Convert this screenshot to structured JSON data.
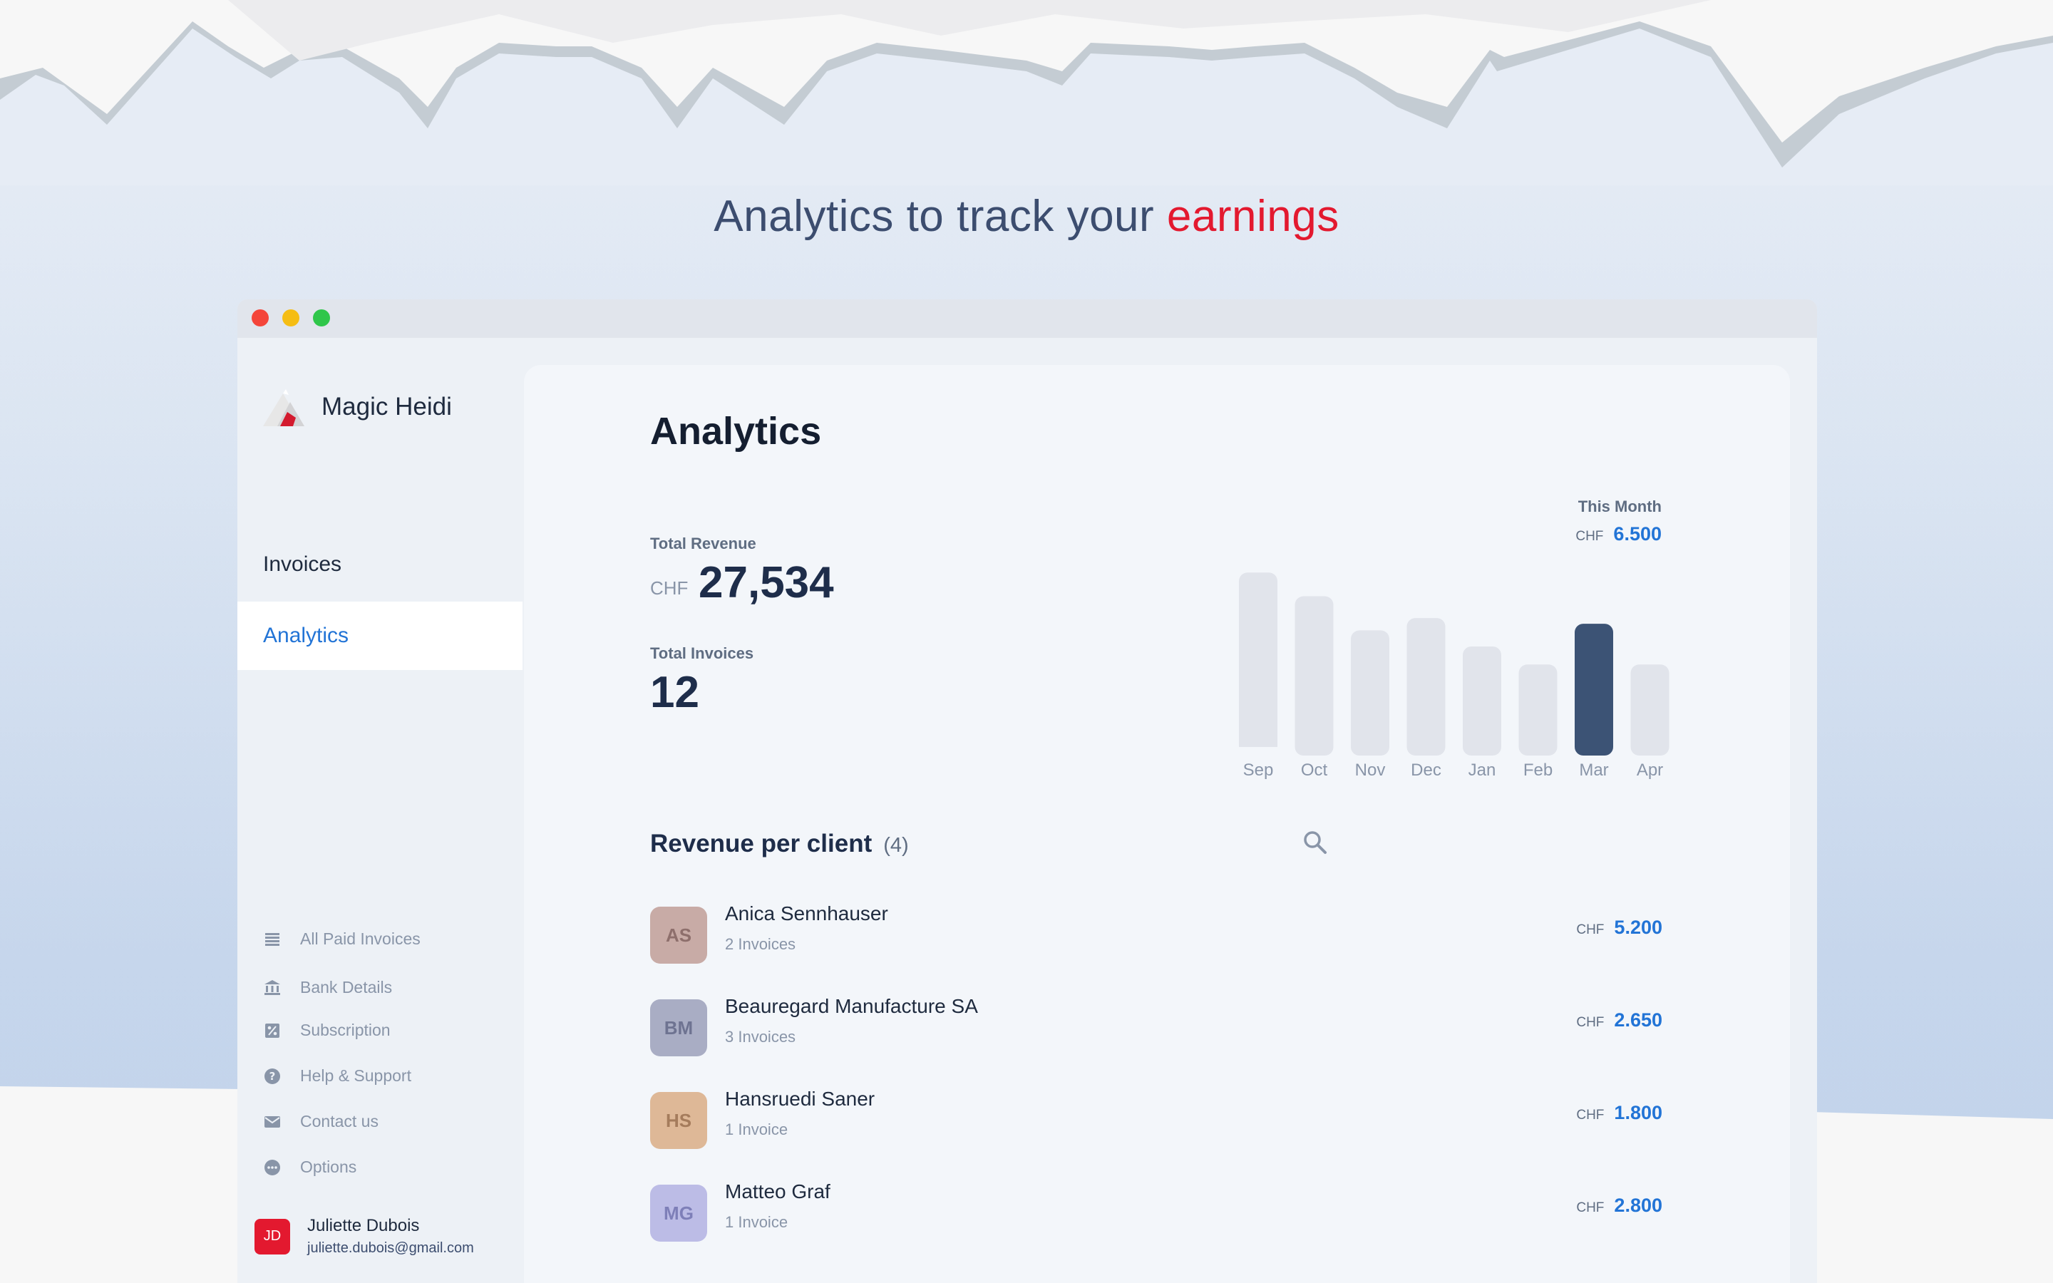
{
  "headline": {
    "prefix": "Analytics to track your",
    "accent": "earnings"
  },
  "app": {
    "name": "Magic Heidi"
  },
  "sidebar": {
    "nav": [
      {
        "label": "Invoices",
        "active": false
      },
      {
        "label": "Analytics",
        "active": true
      }
    ],
    "settings": [
      {
        "label": "All Paid Invoices",
        "icon": "list-icon"
      },
      {
        "label": "Bank Details",
        "icon": "bank-icon"
      },
      {
        "label": "Subscription",
        "icon": "percent-icon"
      },
      {
        "label": "Help & Support",
        "icon": "help-icon"
      },
      {
        "label": "Contact us",
        "icon": "mail-icon"
      },
      {
        "label": "Options",
        "icon": "options-icon"
      }
    ],
    "user": {
      "initials": "JD",
      "name": "Juliette Dubois",
      "email": "juliette.dubois@gmail.com"
    }
  },
  "main": {
    "title": "Analytics",
    "total_revenue": {
      "label": "Total Revenue",
      "currency": "CHF",
      "value": "27,534"
    },
    "total_invoices": {
      "label": "Total Invoices",
      "value": "12"
    },
    "this_month": {
      "label": "This Month",
      "currency": "CHF",
      "value": "6.500"
    },
    "revenue_section": {
      "title": "Revenue per client",
      "count": "(4)"
    },
    "clients": [
      {
        "initials": "AS",
        "name": "Anica Sennhauser",
        "invoices": "2 Invoices",
        "currency": "CHF",
        "amount": "5.200",
        "bg": "#c8aba6",
        "fg": "#8e6f6c"
      },
      {
        "initials": "BM",
        "name": "Beauregard Manufacture SA",
        "invoices": "3 Invoices",
        "currency": "CHF",
        "amount": "2.650",
        "bg": "#a9adc4",
        "fg": "#6e7391"
      },
      {
        "initials": "HS",
        "name": "Hansruedi Saner",
        "invoices": "1 Invoice",
        "currency": "CHF",
        "amount": "1.800",
        "bg": "#deb897",
        "fg": "#a57c5c"
      },
      {
        "initials": "MG",
        "name": "Matteo Graf",
        "invoices": "1 Invoice",
        "currency": "CHF",
        "amount": "2.800",
        "bg": "#bcbce6",
        "fg": "#7e7fb8"
      }
    ]
  },
  "colors": {
    "accent_red": "#e3192f",
    "accent_blue": "#2274d6",
    "bar_default": "#e1e4eb",
    "bar_active": "#3c5375"
  },
  "chart_data": {
    "type": "bar",
    "categories": [
      "Sep",
      "Oct",
      "Nov",
      "Dec",
      "Jan",
      "Feb",
      "Mar",
      "Apr"
    ],
    "values": [
      9200,
      7950,
      6150,
      6800,
      5300,
      4350,
      6500,
      4350
    ],
    "highlight": "Mar",
    "ylim": [
      0,
      10000
    ],
    "grid": false
  }
}
